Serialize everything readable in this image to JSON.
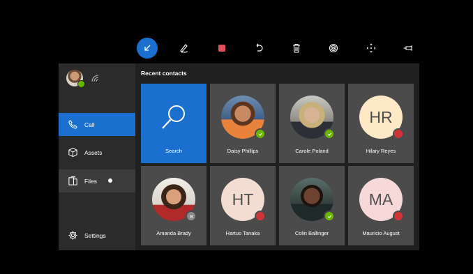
{
  "toolbar": {
    "tools": [
      {
        "icon": "minimize-arrow-icon",
        "active": true
      },
      {
        "icon": "pen-icon"
      },
      {
        "icon": "stop-square-icon",
        "color": "#e0505f"
      },
      {
        "icon": "undo-icon"
      },
      {
        "icon": "trash-icon"
      },
      {
        "icon": "fingerprint-icon"
      },
      {
        "icon": "move-icon"
      },
      {
        "icon": "pin-icon"
      }
    ]
  },
  "sidebar": {
    "items": [
      {
        "label": "Call",
        "icon": "phone-icon",
        "selected": true
      },
      {
        "label": "Assets",
        "icon": "cube-icon"
      },
      {
        "label": "Files",
        "icon": "files-icon"
      },
      {
        "label": "Settings",
        "icon": "gear-icon"
      }
    ]
  },
  "main": {
    "title": "Recent contacts",
    "contacts": [
      {
        "name": "Search"
      },
      {
        "name": "Daisy Phillips",
        "status": "available"
      },
      {
        "name": "Carole Poland",
        "status": "available"
      },
      {
        "name": "Hilary Reyes",
        "initials": "HR",
        "status": "busy"
      },
      {
        "name": "Amanda Brady",
        "status": "offline"
      },
      {
        "name": "Hartuo Tanaka",
        "initials": "HT",
        "status": "busy"
      },
      {
        "name": "Colin Ballinger",
        "status": "available"
      },
      {
        "name": "Mauricio August",
        "initials": "MA",
        "status": "busy"
      }
    ]
  },
  "colors": {
    "accent": "#1a6fcf",
    "available": "#6bb700",
    "busy": "#d13438"
  }
}
